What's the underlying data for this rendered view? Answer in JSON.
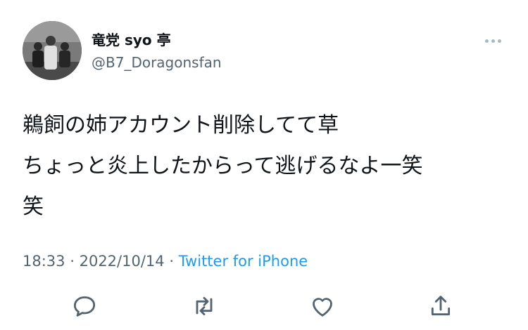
{
  "user": {
    "display_name": "竜党 syo 亭",
    "handle": "@B7_Doragonsfan",
    "avatar": "avatar-photo"
  },
  "tweet": {
    "lines": [
      "鵜飼の姉アカウント削除してて草",
      "ちょっと炎上したからって逃げるなよ一笑",
      "笑"
    ],
    "time": "18:33",
    "date": "2022/10/14",
    "separator": "·",
    "source": "Twitter for iPhone"
  },
  "actions": [
    {
      "icon": "reply-icon"
    },
    {
      "icon": "retweet-icon"
    },
    {
      "icon": "like-icon"
    },
    {
      "icon": "share-icon"
    }
  ],
  "more_icon": "more-icon",
  "colors": {
    "text": "#0f1419",
    "secondary": "#536471",
    "link": "#1d9bf0",
    "icon": "#536471"
  }
}
